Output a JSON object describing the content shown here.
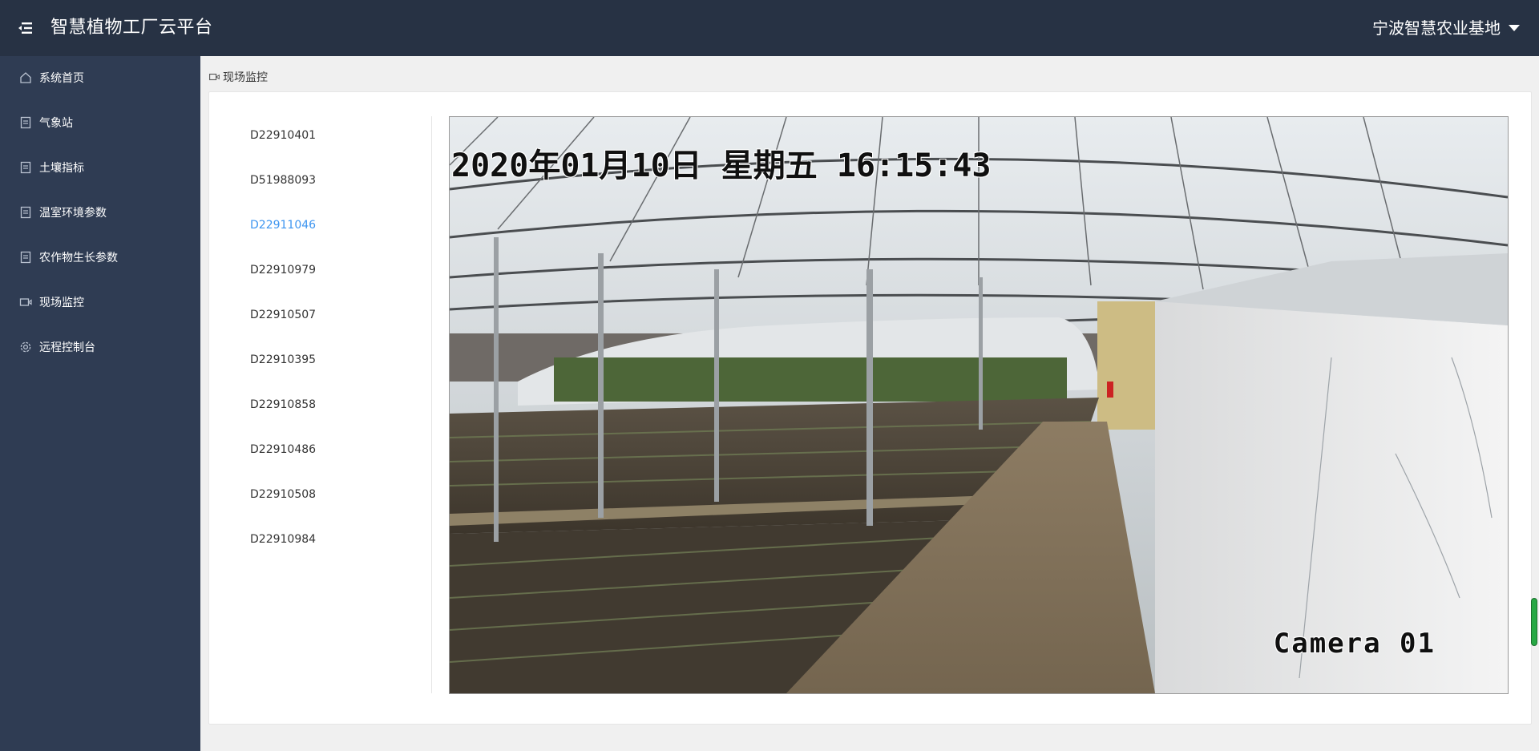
{
  "header": {
    "app_title": "智慧植物工厂云平台",
    "org_name": "宁波智慧农业基地",
    "menu_icon": "menu-fold-icon",
    "dropdown_icon": "caret-down-icon"
  },
  "sidebar": {
    "items": [
      {
        "label": "系统首页",
        "icon": "home-icon"
      },
      {
        "label": "气象站",
        "icon": "document-icon"
      },
      {
        "label": "土壤指标",
        "icon": "document-icon"
      },
      {
        "label": "温室环境参数",
        "icon": "document-icon"
      },
      {
        "label": "农作物生长参数",
        "icon": "document-icon"
      },
      {
        "label": "现场监控",
        "icon": "video-camera-icon"
      },
      {
        "label": "远程控制台",
        "icon": "gear-icon"
      }
    ]
  },
  "breadcrumb": {
    "label": "现场监控",
    "icon": "video-camera-icon"
  },
  "devices": {
    "selected": "D22911046",
    "items": [
      "D22910401",
      "D51988093",
      "D22911046",
      "D22910979",
      "D22910507",
      "D22910395",
      "D22910858",
      "D22910486",
      "D22910508",
      "D22910984"
    ]
  },
  "video": {
    "timestamp": "2020年01月10日  星期五  16:15:43",
    "camera_label": "Camera 01"
  },
  "colors": {
    "topbar": "#273244",
    "sidebar": "#2f3c53",
    "active_link": "#3d95f0",
    "scroll_thumb": "#27a844"
  }
}
